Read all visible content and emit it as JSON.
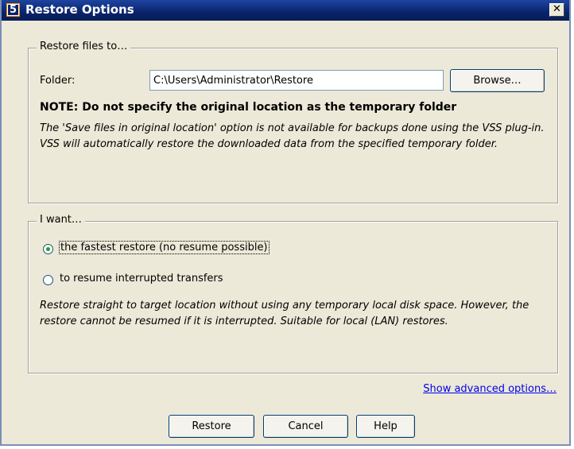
{
  "window": {
    "title": "Restore Options",
    "app_icon_glyph": "5",
    "close_glyph": "✕"
  },
  "restore_files": {
    "legend": "Restore files to…",
    "folder_label": "Folder:",
    "folder_value": "C:\\Users\\Administrator\\Restore",
    "browse_label": "Browse…",
    "note_title": "NOTE: Do not specify the original location as the temporary folder",
    "note_text": "The 'Save files in original location' option is not available for backups done using the VSS plug-in. VSS will automatically restore the downloaded data from the specified temporary folder."
  },
  "i_want": {
    "legend": "I want…",
    "options": [
      {
        "label": "the fastest restore (no resume possible)",
        "checked": true
      },
      {
        "label": "to resume interrupted transfers",
        "checked": false
      }
    ],
    "description": "Restore straight to target location without using any temporary local disk space. However, the restore cannot be resumed if it is interrupted. Suitable for local (LAN) restores."
  },
  "advanced_link": "Show advanced options…",
  "buttons": {
    "restore": "Restore",
    "cancel": "Cancel",
    "help": "Help"
  }
}
